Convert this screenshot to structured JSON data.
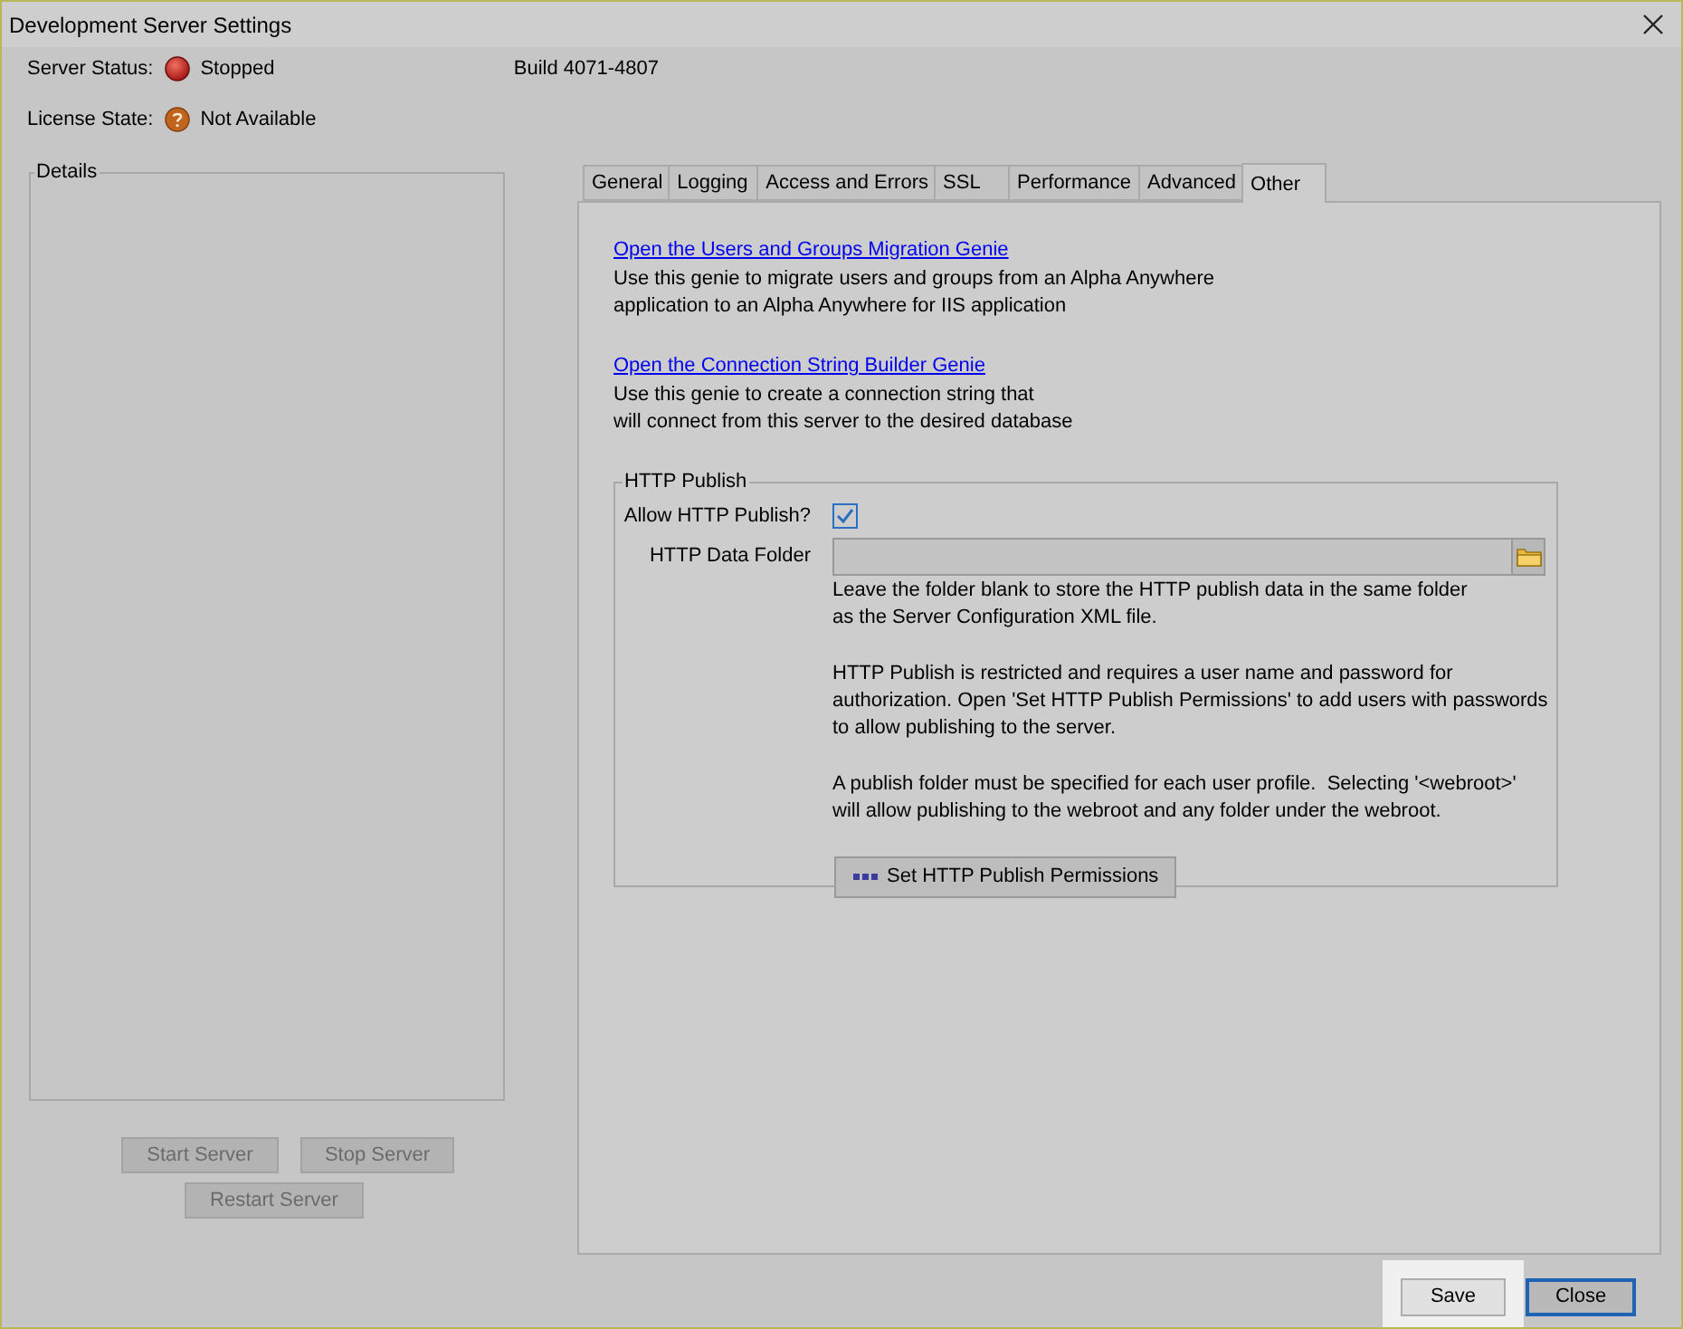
{
  "window": {
    "title": "Development Server Settings"
  },
  "status": [
    {
      "label": "Server Status:",
      "value": "Stopped",
      "kind": "stopped"
    },
    {
      "label": "License State:",
      "value": "Not Available",
      "kind": "unknown"
    }
  ],
  "build": "Build 4071-4807",
  "details": {
    "title": "Details"
  },
  "server_buttons": [
    {
      "label": "Start Server",
      "disabled": true
    },
    {
      "label": "Stop Server",
      "disabled": true
    },
    {
      "label": "Restart Server",
      "disabled": true
    }
  ],
  "tabs": [
    {
      "label": "General",
      "selected": false
    },
    {
      "label": "Logging",
      "selected": false
    },
    {
      "label": "Access and Errors",
      "selected": false
    },
    {
      "label": "SSL",
      "selected": false
    },
    {
      "label": "Performance",
      "selected": false
    },
    {
      "label": "Advanced",
      "selected": false
    },
    {
      "label": "Other",
      "selected": true
    }
  ],
  "genies": [
    {
      "link": "Open the Users and Groups Migration Genie",
      "description_lines": [
        "Use this genie to migrate users and groups from an Alpha Anywhere",
        "application to an Alpha Anywhere for IIS application"
      ]
    },
    {
      "link": "Open the Connection String Builder Genie",
      "description_lines": [
        "Use this genie to create a connection string that",
        "will connect from this server to the desired database"
      ]
    }
  ],
  "http_publish": {
    "title": "HTTP Publish",
    "allow_label": "Allow HTTP Publish?",
    "allow_checked": true,
    "folder_label": "HTTP Data Folder",
    "notes": [
      [
        "Leave the folder blank to store the HTTP publish data in the same folder",
        "as the Server Configuration XML file."
      ],
      [
        "HTTP Publish is restricted and requires a user name and password for",
        "authorization. Open 'Set HTTP Publish Permissions' to add users with passwords",
        "to allow publishing to the server."
      ],
      [
        "A publish folder must be specified for each user profile.  Selecting '<webroot>'",
        "will allow publishing to the webroot and any folder under the webroot."
      ]
    ],
    "permissions_button": "Set HTTP Publish Permissions"
  },
  "footer_buttons": [
    {
      "label": "Save",
      "hovered": true,
      "focused": false
    },
    {
      "label": "Close",
      "hovered": false,
      "focused": true
    }
  ]
}
